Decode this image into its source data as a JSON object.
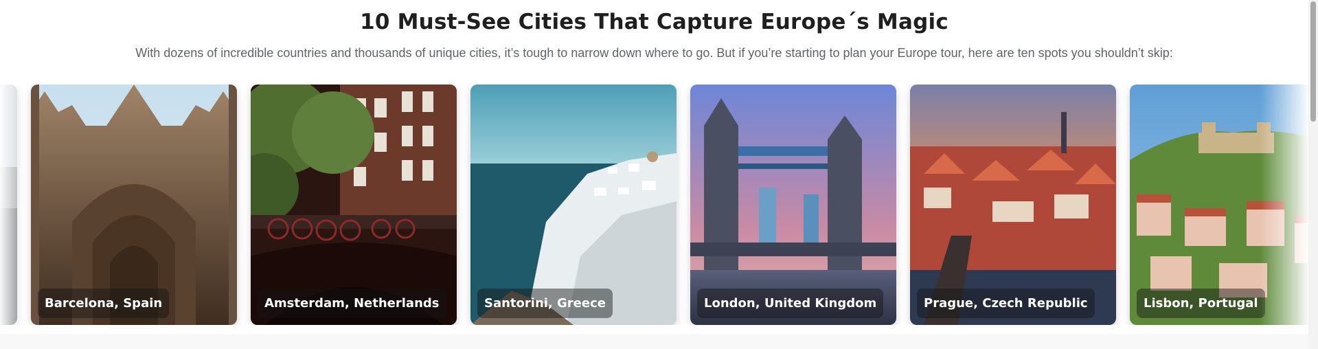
{
  "header": {
    "title": "10 Must-See Cities That Capture Europe´s Magic",
    "subtitle": "With dozens of incredible countries and thousands of unique cities, it’s tough to narrow down where to go. But if you’re starting to plan your Europe tour, here are ten spots you shouldn’t skip:"
  },
  "carousel": {
    "cards": [
      {
        "label": "",
        "image": "city-photo",
        "palette": [
          "#cfd6db",
          "#8b8f92",
          "#5e6266"
        ]
      },
      {
        "label": "Barcelona, Spain",
        "image": "gothic-cathedral-facade-photo",
        "palette": [
          "#c7dfee",
          "#8a6e54",
          "#4a3626"
        ]
      },
      {
        "label": "Amsterdam, Netherlands",
        "image": "canal-bicycles-photo",
        "palette": [
          "#5f7f3c",
          "#6b3a2a",
          "#1f0f0d"
        ]
      },
      {
        "label": "Santorini, Greece",
        "image": "whitewashed-cliff-village-photo",
        "palette": [
          "#5fa8b8",
          "#1e5a6a",
          "#e9eef0"
        ]
      },
      {
        "label": "London, United Kingdom",
        "image": "tower-bridge-photo",
        "palette": [
          "#7b8fd6",
          "#c98aa4",
          "#36415c"
        ]
      },
      {
        "label": "Prague, Czech Republic",
        "image": "red-roofs-bridge-photo",
        "palette": [
          "#e8915a",
          "#b0483a",
          "#2e3a52"
        ]
      },
      {
        "label": "Lisbon, Portugal",
        "image": "hillside-castle-photo",
        "palette": [
          "#6fa7d6",
          "#5e8a3a",
          "#d7a18a"
        ]
      }
    ]
  },
  "scrollbar": {
    "visible": true
  }
}
